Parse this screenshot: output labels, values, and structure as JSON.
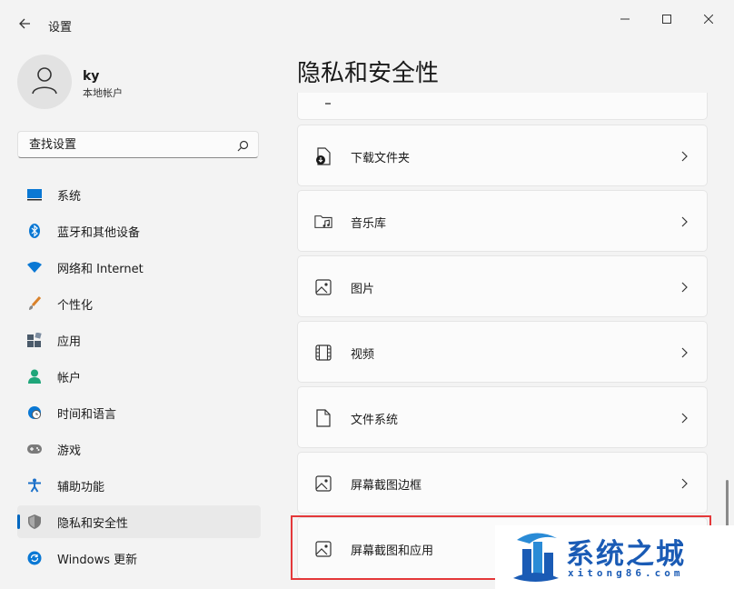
{
  "window": {
    "title": "设置",
    "controls": [
      "minimize-icon",
      "maximize-icon",
      "close-icon"
    ]
  },
  "account": {
    "name": "ky",
    "type": "本地帐户"
  },
  "search": {
    "placeholder": "查找设置"
  },
  "sidebar": {
    "items": [
      {
        "label": "系统",
        "icon": "display-icon",
        "color": "#0a78d4"
      },
      {
        "label": "蓝牙和其他设备",
        "icon": "bluetooth-icon",
        "color": "#0a78d4"
      },
      {
        "label": "网络和 Internet",
        "icon": "wifi-icon",
        "color": "#0a78d4"
      },
      {
        "label": "个性化",
        "icon": "brush-icon",
        "color": "#d9822b"
      },
      {
        "label": "应用",
        "icon": "apps-icon",
        "color": "#4a5a6a"
      },
      {
        "label": "帐户",
        "icon": "person-icon",
        "color": "#1fa67a"
      },
      {
        "label": "时间和语言",
        "icon": "globe-clock-icon",
        "color": "#0a78d4"
      },
      {
        "label": "游戏",
        "icon": "gamepad-icon",
        "color": "#6b6b6b"
      },
      {
        "label": "辅助功能",
        "icon": "accessibility-icon",
        "color": "#1b70c9"
      },
      {
        "label": "隐私和安全性",
        "icon": "shield-icon",
        "color": "#6b6b6b",
        "active": true
      },
      {
        "label": "Windows 更新",
        "icon": "update-icon",
        "color": "#0a78d4"
      }
    ]
  },
  "main": {
    "title": "隐私和安全性",
    "rows": [
      {
        "label": "下载文件夹",
        "icon": "download-file-icon"
      },
      {
        "label": "音乐库",
        "icon": "music-folder-icon"
      },
      {
        "label": "图片",
        "icon": "picture-icon"
      },
      {
        "label": "视频",
        "icon": "video-icon"
      },
      {
        "label": "文件系统",
        "icon": "file-icon"
      },
      {
        "label": "屏幕截图边框",
        "icon": "screenshot-border-icon"
      },
      {
        "label": "屏幕截图和应用",
        "icon": "screenshot-apps-icon"
      }
    ]
  },
  "watermark": {
    "title": "系统之城",
    "url": "xitong86.com"
  },
  "colors": {
    "accent": "#0067c0",
    "highlight": "#e4383a",
    "watermark": "#1a5bb5"
  }
}
